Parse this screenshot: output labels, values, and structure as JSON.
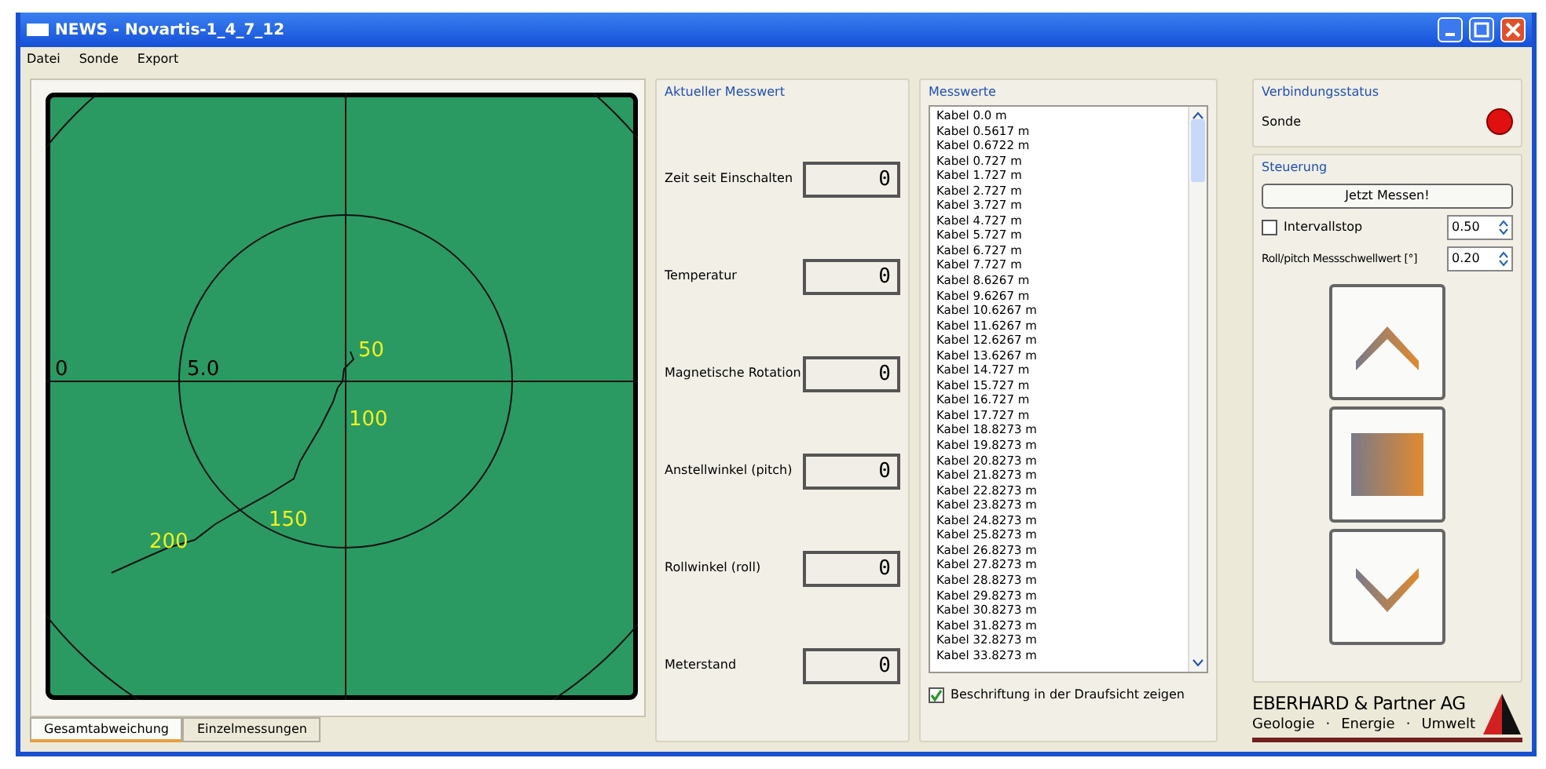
{
  "window": {
    "title": "NEWS - Novartis-1_4_7_12"
  },
  "menu": [
    "Datei",
    "Sonde",
    "Export"
  ],
  "plot": {
    "axis_labels": [
      "0",
      "5.0"
    ],
    "depth_labels": [
      "50",
      "100",
      "150",
      "200"
    ]
  },
  "tabs": [
    {
      "label": "Gesamtabweichung",
      "selected": true
    },
    {
      "label": "Einzelmessungen",
      "selected": false
    }
  ],
  "current_value": {
    "title": "Aktueller Messwert",
    "fields": [
      {
        "label": "Zeit seit Einschalten",
        "value": "0"
      },
      {
        "label": "Temperatur",
        "value": "0"
      },
      {
        "label": "Magnetische Rotation",
        "value": "0"
      },
      {
        "label": "Anstellwinkel (pitch)",
        "value": "0"
      },
      {
        "label": "Rollwinkel (roll)",
        "value": "0"
      },
      {
        "label": "Meterstand",
        "value": "0"
      }
    ]
  },
  "measurements": {
    "title": "Messwerte",
    "items": [
      "Kabel 0.0 m",
      "Kabel 0.5617 m",
      "Kabel 0.6722 m",
      "Kabel 0.727 m",
      "Kabel 1.727 m",
      "Kabel 2.727 m",
      "Kabel 3.727 m",
      "Kabel 4.727 m",
      "Kabel 5.727 m",
      "Kabel 6.727 m",
      "Kabel 7.727 m",
      "Kabel 8.6267 m",
      "Kabel 9.6267 m",
      "Kabel 10.6267 m",
      "Kabel 11.6267 m",
      "Kabel 12.6267 m",
      "Kabel 13.6267 m",
      "Kabel 14.727 m",
      "Kabel 15.727 m",
      "Kabel 16.727 m",
      "Kabel 17.727 m",
      "Kabel 18.8273 m",
      "Kabel 19.8273 m",
      "Kabel 20.8273 m",
      "Kabel 21.8273 m",
      "Kabel 22.8273 m",
      "Kabel 23.8273 m",
      "Kabel 24.8273 m",
      "Kabel 25.8273 m",
      "Kabel 26.8273 m",
      "Kabel 27.8273 m",
      "Kabel 28.8273 m",
      "Kabel 29.8273 m",
      "Kabel 30.8273 m",
      "Kabel 31.8273 m",
      "Kabel 32.8273 m",
      "Kabel 33.8273 m"
    ],
    "show_labels": {
      "label": "Beschriftung in der Draufsicht zeigen",
      "checked": true
    }
  },
  "connection": {
    "title": "Verbindungsstatus",
    "label": "Sonde",
    "color": "#e01010"
  },
  "control": {
    "title": "Steuerung",
    "button": "Jetzt Messen!",
    "interval": {
      "label": "Intervallstop",
      "checked": false,
      "value": "0.50"
    },
    "threshold": {
      "label": "Roll/pitch Messschwellwert [°]",
      "value": "0.20"
    }
  },
  "logo": {
    "name": "EBERHARD & Partner AG",
    "tags": [
      "Geologie",
      "Energie",
      "Umwelt"
    ],
    "separator": "·"
  }
}
